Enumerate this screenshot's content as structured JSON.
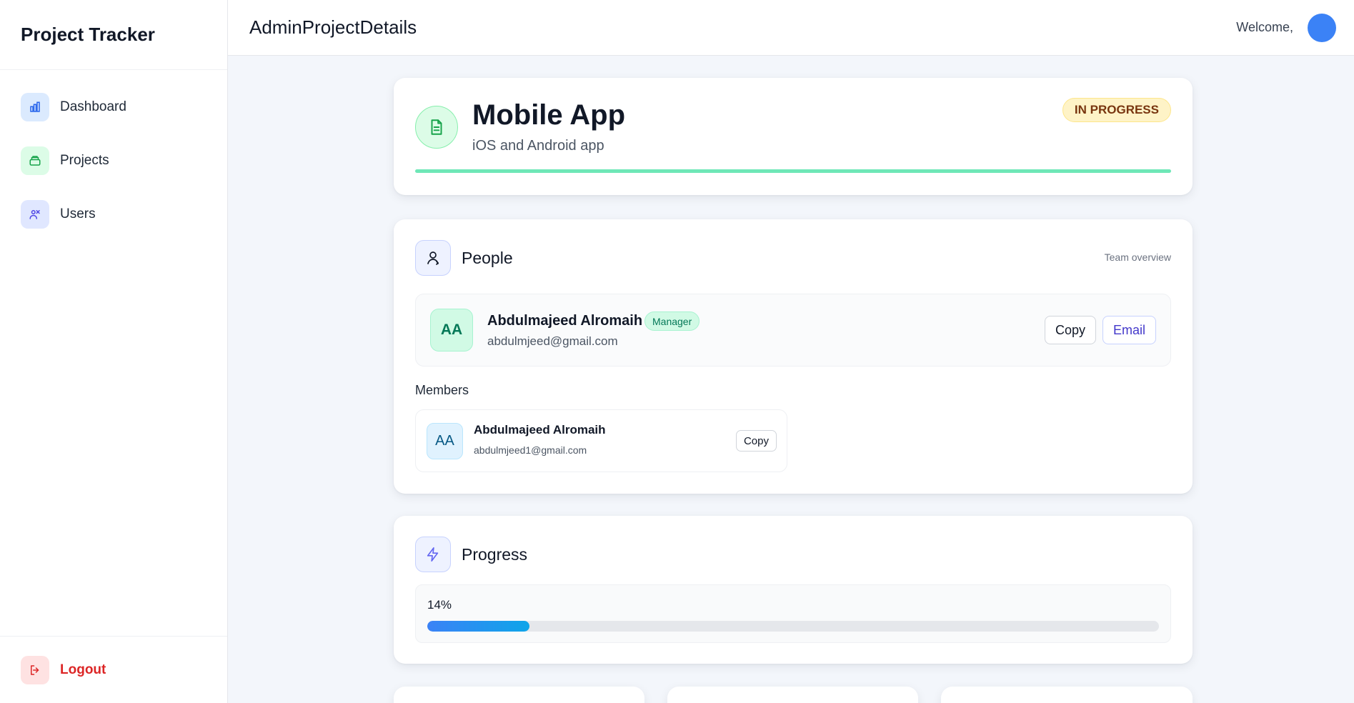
{
  "app": {
    "brand": "Project Tracker"
  },
  "sidebar": {
    "items": [
      {
        "label": "Dashboard",
        "icon": "bar-chart-icon",
        "color": "#2563eb",
        "bg": "#dbeafe"
      },
      {
        "label": "Projects",
        "icon": "folder-icon",
        "color": "#16a34a",
        "bg": "#dcfce7"
      },
      {
        "label": "Users",
        "icon": "users-icon",
        "color": "#4f46e5",
        "bg": "#e0e7ff"
      }
    ],
    "logout_label": "Logout"
  },
  "header": {
    "page_title": "AdminProjectDetails",
    "welcome": "Welcome,"
  },
  "project": {
    "name": "Mobile App",
    "description": "iOS and Android app",
    "status": "IN PROGRESS",
    "icon": "document-icon"
  },
  "people": {
    "title": "People",
    "subtitle": "Team overview",
    "icon": "people-icon",
    "manager": {
      "initials": "AA",
      "name": "Abdulmajeed Alromaih",
      "role": "Manager",
      "email": "abdulmjeed@gmail.com",
      "copy_label": "Copy",
      "email_label": "Email"
    },
    "members_label": "Members",
    "members": [
      {
        "initials": "AA",
        "name": "Abdulmajeed Alromaih",
        "email": "abdulmjeed1@gmail.com",
        "copy_label": "Copy"
      }
    ]
  },
  "progress": {
    "title": "Progress",
    "icon": "lightning-icon",
    "percent_label": "14%",
    "value": 0.14
  },
  "colors": {
    "accent": "#3b82f6",
    "status_bg": "#fef3c7",
    "logout": "#dc2626"
  }
}
